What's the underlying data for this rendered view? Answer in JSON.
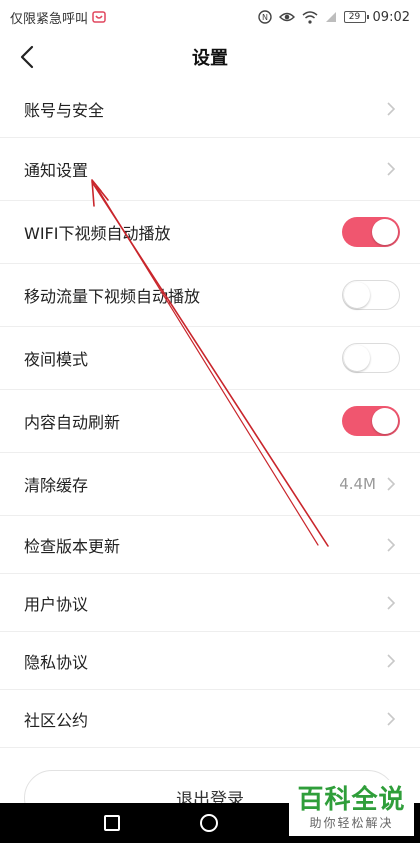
{
  "status_bar": {
    "left_text": "仅限紧急呼叫",
    "battery": "29",
    "time": "09:02",
    "icons": [
      "sim-app-icon",
      "nfc-icon",
      "eye-icon",
      "wifi-icon",
      "signal-icon",
      "battery-icon"
    ]
  },
  "header": {
    "title": "设置",
    "back_icon": "back-arrow-icon"
  },
  "settings": {
    "account": {
      "label": "账号与安全"
    },
    "notifications": {
      "label": "通知设置"
    },
    "wifi_autoplay": {
      "label": "WIFI下视频自动播放",
      "enabled": true
    },
    "mobile_autoplay": {
      "label": "移动流量下视频自动播放",
      "enabled": false
    },
    "night_mode": {
      "label": "夜间模式",
      "enabled": false
    },
    "auto_refresh": {
      "label": "内容自动刷新",
      "enabled": true
    },
    "clear_cache": {
      "label": "清除缓存",
      "value": "4.4M"
    },
    "check_update": {
      "label": "检查版本更新"
    },
    "user_agreement": {
      "label": "用户协议"
    },
    "privacy_agreement": {
      "label": "隐私协议"
    },
    "community_rules": {
      "label": "社区公约"
    }
  },
  "logout": {
    "label": "退出登录"
  },
  "watermark": {
    "title": "百科全说",
    "subtitle": "助你轻松解决"
  },
  "colors": {
    "toggle_on": "#f0566f",
    "annotation_arrow": "#c9262c",
    "watermark_green": "#2f9e3a"
  }
}
